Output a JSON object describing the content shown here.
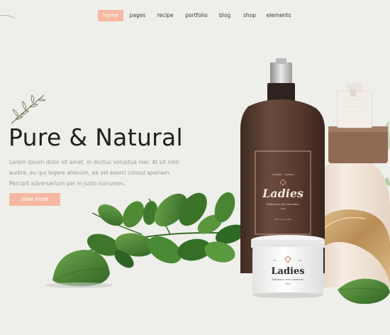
{
  "nav": {
    "items": [
      "home",
      "pages",
      "recipe",
      "portfolio",
      "blog",
      "shop",
      "elements"
    ],
    "active_index": 0
  },
  "hero": {
    "title": "Pure & Natural",
    "body": "Lorem ipsum dolor sit amet, in doctus voluptua mei. At sit nibh audire, eu qui legere alienum, ea vel exerci consul aperiam. Percipit adversarium per in justo nonumes.",
    "cta_label": "view more"
  },
  "product": {
    "bottle_brand": "Ladies",
    "bottle_subtitle": "Stationery and Cosmetics",
    "bottle_small_1": "Hero",
    "bottle_small_2": "With Sprays Est",
    "jar_brand": "Ladies",
    "jar_subtitle": "Stationery and Cosmetics",
    "jar_small": "Hero"
  },
  "colors": {
    "accent": "#f6b8a2",
    "background": "#eeefea",
    "headline": "#1f1f1f",
    "bottle": "#5b4034",
    "leaf": "#4e8a35"
  }
}
